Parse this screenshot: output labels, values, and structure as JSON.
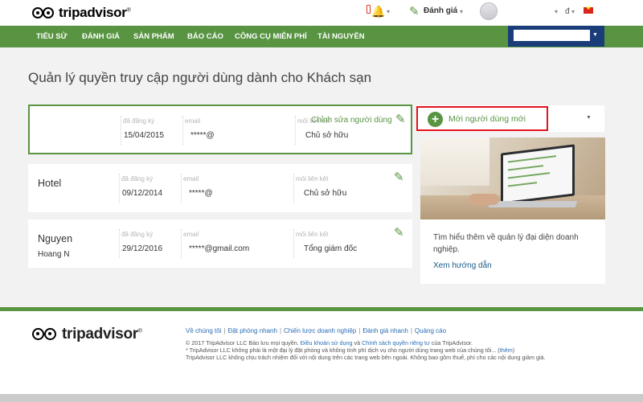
{
  "brand": {
    "name": "tripadvisor",
    "mark": "®"
  },
  "header": {
    "review_label": "Đánh giá",
    "currency": "đ"
  },
  "nav": {
    "items": [
      "TIỂU SỬ",
      "ĐÁNH GIÁ",
      "SẢN PHẨM",
      "BÁO CÁO",
      "CÔNG CỤ MIỄN PHÍ",
      "TÀI NGUYÊN"
    ]
  },
  "page": {
    "title": "Quản lý quyền truy cập người dùng dành cho Khách sạn"
  },
  "labels": {
    "registered": "đã đăng ký",
    "email": "email",
    "relation": "mối liên kết",
    "edit_user": "Chỉnh sửa người dùng"
  },
  "users": [
    {
      "name": "",
      "name2": "",
      "registered": "15/04/2015",
      "email": "*****@",
      "relation": "Chủ sở hữu"
    },
    {
      "name": "Hotel",
      "name2": "",
      "registered": "09/12/2014",
      "email": "*****@",
      "relation": "Chủ sở hữu"
    },
    {
      "name": "Nguyen",
      "name2": "Hoang N",
      "registered": "29/12/2016",
      "email": "*****@gmail.com",
      "relation": "Tổng giám đốc"
    }
  ],
  "new_user": {
    "label": "Mời người dùng mới"
  },
  "promo": {
    "text": "Tìm hiểu thêm về quản lý đại diện doanh nghiệp.",
    "link": "Xem hướng dẫn"
  },
  "footer": {
    "links": [
      "Về chúng tôi",
      "Đặt phòng nhanh",
      "Chiến lược doanh nghiệp",
      "Đánh giá nhanh",
      "Quảng cáo"
    ],
    "copyright_pre": "© 2017 TripAdvisor LLC Bảo lưu mọi quyền. ",
    "terms": "Điều khoản sử dụng",
    "and": " và ",
    "privacy": "Chính sách quyền riêng tư",
    "copyright_post": " của TripAdvisor.",
    "disclaimer_pre": "* TripAdvisor LLC không phải là một đại lý đặt phòng và không tính phí dịch vụ cho người dùng trang web của chúng tôi... (",
    "more": "thêm",
    "disclaimer_post": ")",
    "disclaimer2": "TripAdvisor LLC không chịu trách nhiệm đối với nội dung trên các trang web bên ngoài. Không bao gồm thuế, phí cho các nội dung giảm giá."
  },
  "colors": {
    "green": "#589442",
    "highlight": "#e3131e",
    "account_bar": "#1a3d7a"
  }
}
